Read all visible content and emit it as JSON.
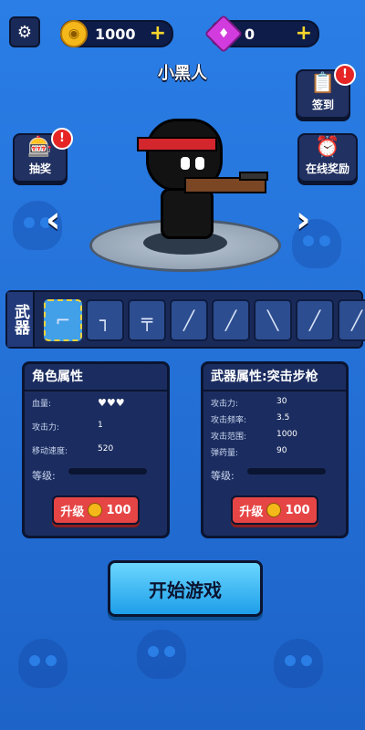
{
  "topbar": {
    "coins": "1000",
    "gems": "0",
    "plus": "+"
  },
  "character": {
    "name": "小黑人"
  },
  "side_buttons": {
    "signin": "签到",
    "lottery": "抽奖",
    "online_reward": "在线奖励",
    "badge": "!"
  },
  "weapons": {
    "label": "武器",
    "slots": [
      "assault-rifle",
      "pistol",
      "submachine-gun",
      "shotgun",
      "heavy-rifle",
      "laser-gun",
      "sniper-rifle",
      "rocket-launcher"
    ],
    "selected_index": 0
  },
  "role_panel": {
    "title": "角色属性",
    "hp_label": "血量:",
    "attack_label": "攻击力:",
    "attack_value": "1",
    "speed_label": "移动速度:",
    "speed_value": "520",
    "level_label": "等级:",
    "upgrade_label": "升级",
    "upgrade_cost": "100"
  },
  "weapon_panel": {
    "title": "武器属性:突击步枪",
    "attack_label": "攻击力:",
    "attack_value": "30",
    "rate_label": "攻击频率:",
    "rate_value": "3.5",
    "range_label": "攻击范围:",
    "range_value": "1000",
    "ammo_label": "弹药量:",
    "ammo_value": "90",
    "level_label": "等级:",
    "upgrade_label": "升级",
    "upgrade_cost": "100"
  },
  "start_button": "开始游戏",
  "colors": {
    "background": "#1f6fd6",
    "panel": "#1b2d60",
    "upgrade": "#e64545",
    "start": "#1e9ee9"
  }
}
